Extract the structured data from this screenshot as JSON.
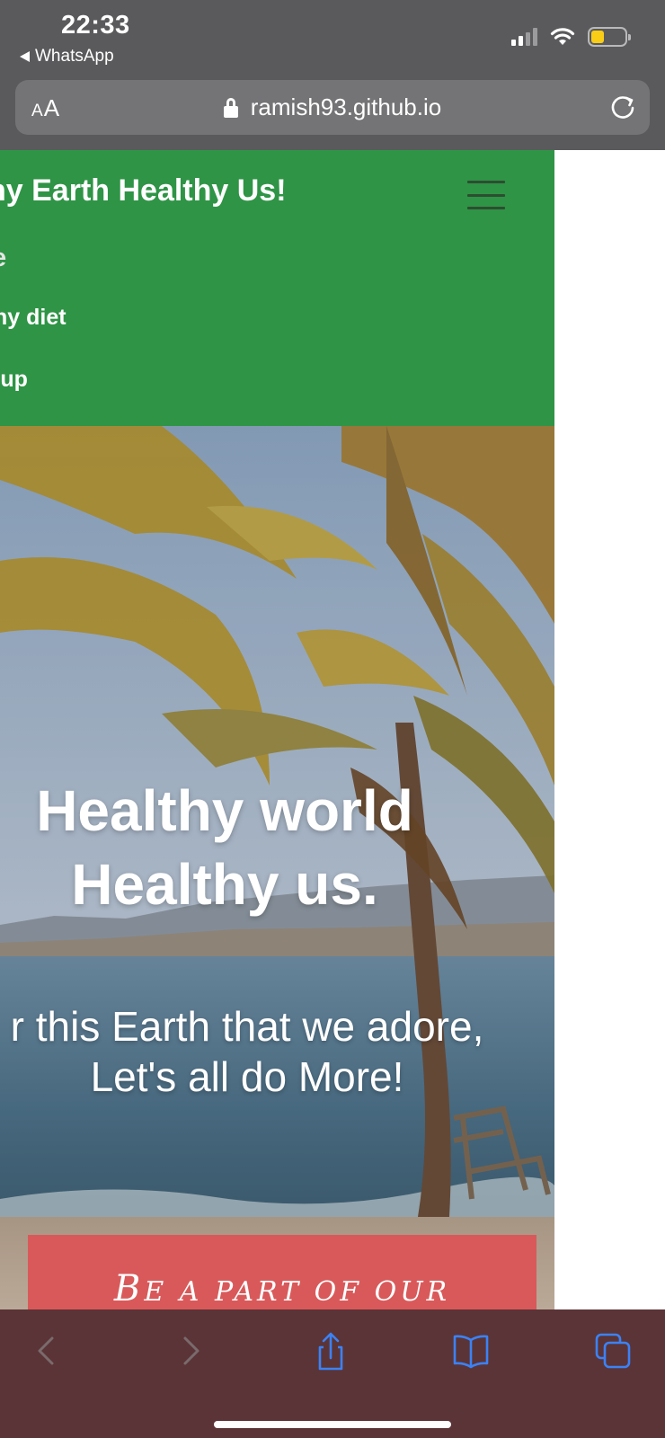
{
  "status_bar": {
    "time": "22:33",
    "back_app": "WhatsApp",
    "battery_color": "#f9cc16"
  },
  "safari": {
    "text_size_label_small": "A",
    "text_size_label_large": "A",
    "url": "ramish93.github.io",
    "reload_icon": "reload-icon",
    "toolbar_icons": [
      "back-arrow-icon",
      "forward-arrow-icon",
      "share-icon",
      "bookmarks-icon",
      "tabs-icon"
    ],
    "tint_color": "#3b82f6"
  },
  "site": {
    "brand": "hy Earth Healthy Us!",
    "nav_color": "#2f9446",
    "nav_items": [
      "e",
      "hy diet",
      "-up"
    ],
    "hero": {
      "title_line1": "Healthy world",
      "title_line2": "Healthy us.",
      "subtitle_line1": "r this Earth that we adore,",
      "subtitle_line2": "Let's all do More!"
    },
    "cta": {
      "text_first_letter": "B",
      "text_rest": "E A PART OF OUR",
      "color": "#d9595a"
    }
  }
}
